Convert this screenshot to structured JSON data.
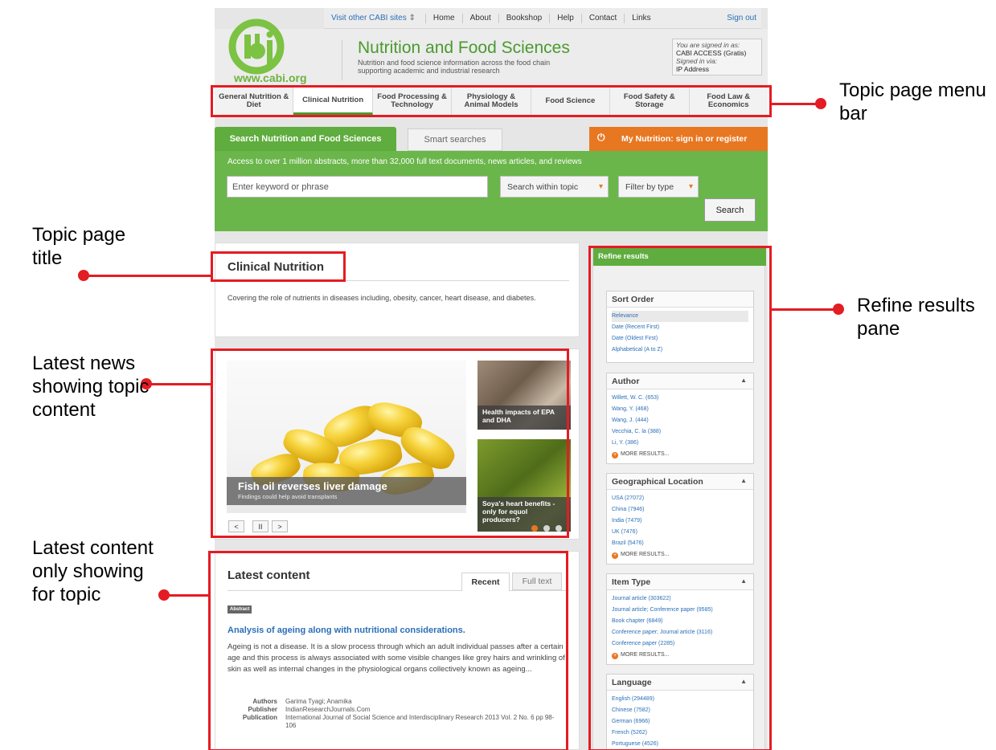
{
  "topbar": {
    "visit": "Visit other CABI sites",
    "visit_arrow": "⇕",
    "home": "Home",
    "about": "About",
    "bookshop": "Bookshop",
    "help": "Help",
    "contact": "Contact",
    "links": "Links",
    "sign_out": "Sign out"
  },
  "header": {
    "logo_url": "www.cabi.org",
    "site_title": "Nutrition and Food Sciences",
    "site_desc": "Nutrition and food science information across the food chain supporting academic and industrial research",
    "signed_label": "You are signed in as:",
    "signed_name": "CABI ACCESS (Gratis)",
    "signed_via_label": "Signed in via:",
    "signed_via": "IP Address"
  },
  "menu": [
    "General Nutrition & Diet",
    "Clinical Nutrition",
    "Food Processing & Technology",
    "Physiology & Animal Models",
    "Food Science",
    "Food Safety & Storage",
    "Food Law & Economics"
  ],
  "search": {
    "tab_main": "Search Nutrition and Food Sciences",
    "tab_smart": "Smart searches",
    "tab_my": "My Nutrition: sign in or register",
    "access": "Access to over 1 million abstracts, more than 32,000 full text documents, news articles, and reviews",
    "keyword_placeholder": "Enter keyword or phrase",
    "within": "Search within topic",
    "filter": "Filter by type",
    "button": "Search"
  },
  "topic": {
    "title": "Clinical Nutrition",
    "desc": "Covering the role of nutrients in diseases including, obesity, cancer, heart disease, and diabetes."
  },
  "news": {
    "main_title": "Fish oil reverses liver damage",
    "main_sub": "Findings could help avoid transplants",
    "thumb1": "Health impacts of EPA and DHA",
    "thumb2": "Soya's heart benefits - only for equol producers?",
    "prev": "<",
    "pause": "II",
    "next": ">"
  },
  "latest": {
    "title": "Latest content",
    "tab_recent": "Recent",
    "tab_full": "Full text",
    "badge": "Abstract",
    "article_title": "Analysis of ageing along with nutritional considerations.",
    "article_text": "Ageing is not a disease. It is a slow process through which an adult individual passes after a certain age and this process is always associated with some visible changes like grey hairs and wrinkling of skin as well as internal changes in the physiological organs collectively known as ageing...",
    "authors_label": "Authors",
    "authors": "Garima Tyagi; Anamika",
    "publisher_label": "Publisher",
    "publisher": "IndianResearchJournals.Com",
    "publication_label": "Publication",
    "publication": "International Journal of Social Science and Interdisciplinary Research 2013 Vol. 2 No. 6 pp 98-106"
  },
  "refine": {
    "title": "Refine results",
    "more": "MORE RESULTS...",
    "sort": {
      "title": "Sort Order",
      "items": [
        "Relevance",
        "Date (Recent First)",
        "Date (Oldest First)",
        "Alphabetical (A to Z)"
      ]
    },
    "author": {
      "title": "Author",
      "items": [
        "Willett, W. C. (653)",
        "Wang, Y. (468)",
        "Wang, J. (444)",
        "Vecchia, C. la (388)",
        "Li, Y. (386)"
      ]
    },
    "geo": {
      "title": "Geographical Location",
      "items": [
        "USA (27072)",
        "China (7946)",
        "India (7479)",
        "UK (7476)",
        "Brazil (5476)"
      ]
    },
    "type": {
      "title": "Item Type",
      "items": [
        "Journal article (303622)",
        "Journal article; Conference paper (9585)",
        "Book chapter (6849)",
        "Conference paper; Journal article (3116)",
        "Conference paper (2285)"
      ]
    },
    "lang": {
      "title": "Language",
      "items": [
        "English (294489)",
        "Chinese (7582)",
        "German (6966)",
        "French (5262)",
        "Portuguese (4526)"
      ]
    }
  },
  "annotations": {
    "menu_bar": "Topic page menu bar",
    "page_title": "Topic page title",
    "refine": "Refine results pane",
    "news": "Latest news showing topic content",
    "latest": "Latest content only showing for topic"
  }
}
